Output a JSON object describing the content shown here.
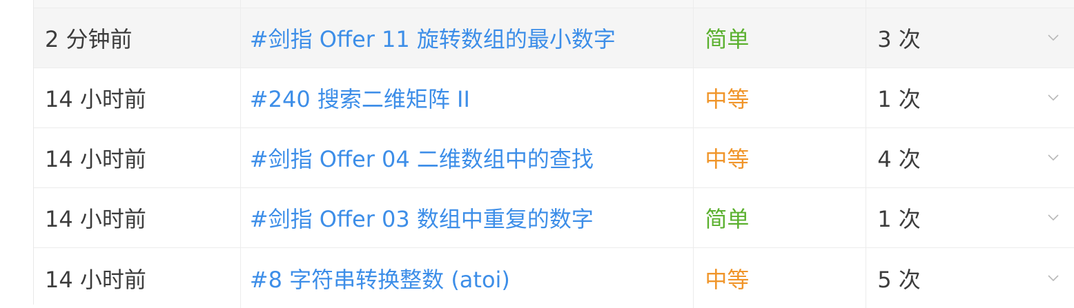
{
  "submissions": {
    "rows": [
      {
        "time": "2 分钟前",
        "title": "#剑指 Offer 11 旋转数组的最小数字",
        "difficulty": "简单",
        "difficulty_level": "easy",
        "attempts": "3 次",
        "highlighted": true
      },
      {
        "time": "14 小时前",
        "title": "#240 搜索二维矩阵 II",
        "difficulty": "中等",
        "difficulty_level": "medium",
        "attempts": "1 次",
        "highlighted": false
      },
      {
        "time": "14 小时前",
        "title": "#剑指 Offer 04 二维数组中的查找",
        "difficulty": "中等",
        "difficulty_level": "medium",
        "attempts": "4 次",
        "highlighted": false
      },
      {
        "time": "14 小时前",
        "title": "#剑指 Offer 03 数组中重复的数字",
        "difficulty": "简单",
        "difficulty_level": "easy",
        "attempts": "1 次",
        "highlighted": false
      },
      {
        "time": "14 小时前",
        "title": "#8 字符串转换整数 (atoi)",
        "difficulty": "中等",
        "difficulty_level": "medium",
        "attempts": "5 次",
        "highlighted": false
      }
    ]
  },
  "colors": {
    "link": "#3d8ee8",
    "easy": "#5ab02e",
    "medium": "#f0952a",
    "text": "#3c3c3c",
    "row_highlight": "#f5f5f5"
  },
  "icons": {
    "expand": "chevron-down-icon"
  }
}
